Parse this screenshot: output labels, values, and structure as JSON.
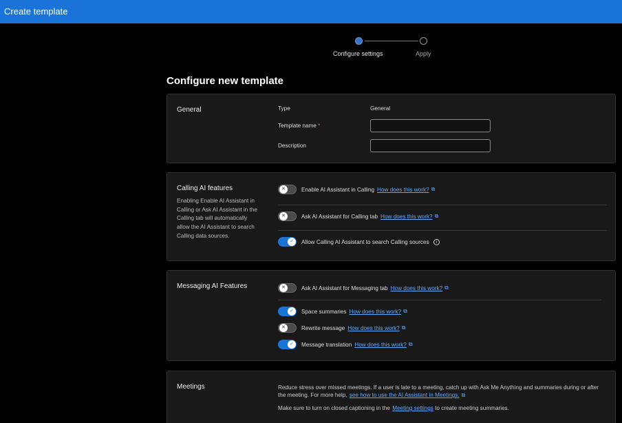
{
  "titlebar": {
    "title": "Create template"
  },
  "stepper": {
    "step1": "Configure settings",
    "step2": "Apply"
  },
  "page": {
    "title": "Configure new template"
  },
  "general": {
    "title": "General",
    "type_label": "Type",
    "type_value": "General",
    "name_label": "Template name",
    "required_mark": "*",
    "name_value": "",
    "desc_label": "Description",
    "desc_value": ""
  },
  "calling": {
    "title": "Calling AI features",
    "description": "Enabling Enable AI Assistant in Calling or Ask AI Assistant in the Calling tab will automatically allow the AI Assistant to search Calling data sources.",
    "toggles": [
      {
        "label": "Enable AI Assistant in Calling",
        "link": "How does this work?",
        "on": false
      },
      {
        "label": "Ask AI Assistant for Calling tab",
        "link": "How does this work?",
        "on": false
      },
      {
        "label": "Allow Calling AI Assistant to search Calling sources",
        "on": true
      }
    ]
  },
  "messaging": {
    "title": "Messaging AI Features",
    "toggles": [
      {
        "label": "Ask AI Assistant for Messaging tab",
        "link": "How does this work?",
        "on": false
      },
      {
        "label": "Space summaries",
        "link": "How does this work?",
        "on": true
      },
      {
        "label": "Rewrite message",
        "link": "How does this work?",
        "on": false
      },
      {
        "label": "Message translation",
        "link": "How does this work?",
        "on": true
      }
    ]
  },
  "meetings": {
    "title": "Meetings",
    "text1": "Reduce stress over missed meetings. If a user is late to a meeting, catch up with Ask Me Anything and summaries during or after the meeting. For more help,",
    "link1": "see how to use the AI Assistant in Meetings.",
    "text2a": "Make sure to turn on closed captioning in the",
    "link2": "Meeting settings",
    "text2b": "to create meeting summaries."
  },
  "icons": {
    "toggle_off": "x-icon",
    "toggle_on": "check-icon",
    "external": "external-link-icon",
    "info": "info-icon"
  },
  "colors": {
    "accent": "#1a73d9",
    "link": "#5fa9ff",
    "required": "#ff5a5a"
  }
}
